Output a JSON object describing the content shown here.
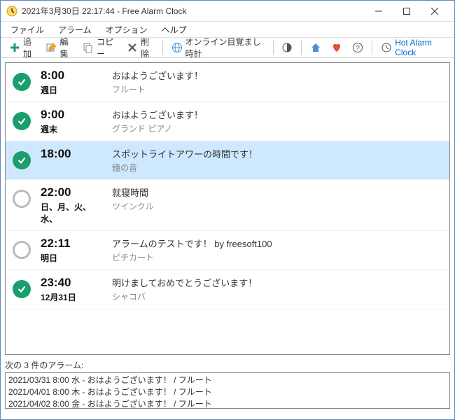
{
  "window": {
    "title": "2021年3月30日 22:17:44 - Free Alarm Clock"
  },
  "menu": {
    "file": "ファイル",
    "alarm": "アラーム",
    "option": "オプション",
    "help": "ヘルプ"
  },
  "toolbar": {
    "add": "追加",
    "edit": "編集",
    "copy": "コピー",
    "delete": "削除",
    "online": "オンライン目覚まし時計",
    "hot": "Hot Alarm Clock"
  },
  "alarms": [
    {
      "enabled": true,
      "time": "8:00",
      "days": "週日",
      "message": "おはようございます！",
      "sound": "フルート",
      "selected": false
    },
    {
      "enabled": true,
      "time": "9:00",
      "days": "週末",
      "message": "おはようございます！",
      "sound": "グランド ピアノ",
      "selected": false
    },
    {
      "enabled": true,
      "time": "18:00",
      "days": "",
      "message": "スポットライトアワーの時間です！",
      "sound": "鐘の音",
      "selected": true
    },
    {
      "enabled": false,
      "time": "22:00",
      "days": "日、月、火、水、",
      "message": "就寝時間",
      "sound": "ツインクル",
      "selected": false
    },
    {
      "enabled": false,
      "time": "22:11",
      "days": "明日",
      "message": "アラームのテストです！ by freesoft100",
      "sound": "ピチカート",
      "selected": false
    },
    {
      "enabled": true,
      "time": "23:40",
      "days": "12月31日",
      "message": "明けましておめでとうございます！",
      "sound": "シャコバ",
      "selected": false
    }
  ],
  "next": {
    "label": "次の 3 件のアラーム:",
    "items": [
      "2021/03/31 8:00 水 - おはようございます！ / フルート",
      "2021/04/01 8:00 木 - おはようございます！ / フルート",
      "2021/04/02 8:00 金 - おはようございます！ / フルート"
    ]
  }
}
